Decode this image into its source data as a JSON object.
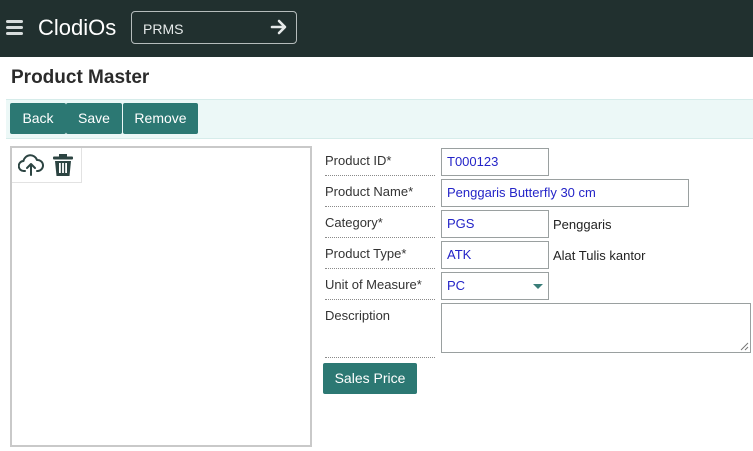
{
  "header": {
    "brand": "ClodiOs",
    "module": "PRMS"
  },
  "page": {
    "title": "Product Master"
  },
  "toolbar": {
    "back_label": "Back",
    "save_label": "Save",
    "remove_label": "Remove"
  },
  "form": {
    "product_id": {
      "label": "Product ID*",
      "value": "T000123"
    },
    "product_name": {
      "label": "Product Name*",
      "value": "Penggaris Butterfly 30 cm"
    },
    "category": {
      "label": "Category*",
      "value": "PGS",
      "description": "Penggaris"
    },
    "product_type": {
      "label": "Product Type*",
      "value": "ATK",
      "description": "Alat Tulis kantor"
    },
    "uom": {
      "label": "Unit of Measure*",
      "value": "PC"
    },
    "description": {
      "label": "Description",
      "value": ""
    }
  },
  "actions": {
    "sales_price_label": "Sales Price"
  },
  "icons": {
    "menu": "hamburger-icon",
    "go": "arrow-right-icon",
    "upload": "cloud-upload-icon",
    "delete": "trash-icon",
    "dropdown": "caret-down-icon"
  },
  "colors": {
    "topbar": "#21302f",
    "primary_button": "#2c7873",
    "toolbar_bg": "#ecf8f7",
    "field_value": "#2424c8"
  }
}
